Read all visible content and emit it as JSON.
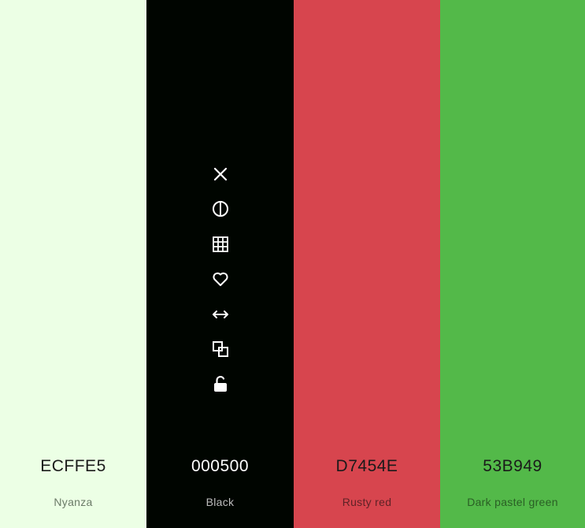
{
  "palette": {
    "colors": [
      {
        "hex": "ECFFE5",
        "name": "Nyanza",
        "bg": "#ECFFE5",
        "hex_color": "#1a1a1a",
        "name_color": "#6b7a68"
      },
      {
        "hex": "000500",
        "name": "Black",
        "bg": "#000500",
        "hex_color": "#ffffff",
        "name_color": "#bdbdbd"
      },
      {
        "hex": "D7454E",
        "name": "Rusty red",
        "bg": "#D7454E",
        "hex_color": "#1a1a1a",
        "name_color": "#5e2226"
      },
      {
        "hex": "53B949",
        "name": "Dark pastel green",
        "bg": "#53B949",
        "hex_color": "#1a1a1a",
        "name_color": "#2a5e25"
      }
    ]
  },
  "toolbar": {
    "icons": [
      "close-icon",
      "contrast-icon",
      "grid-icon",
      "heart-icon",
      "drag-arrows-icon",
      "copy-icon",
      "unlock-icon"
    ]
  }
}
